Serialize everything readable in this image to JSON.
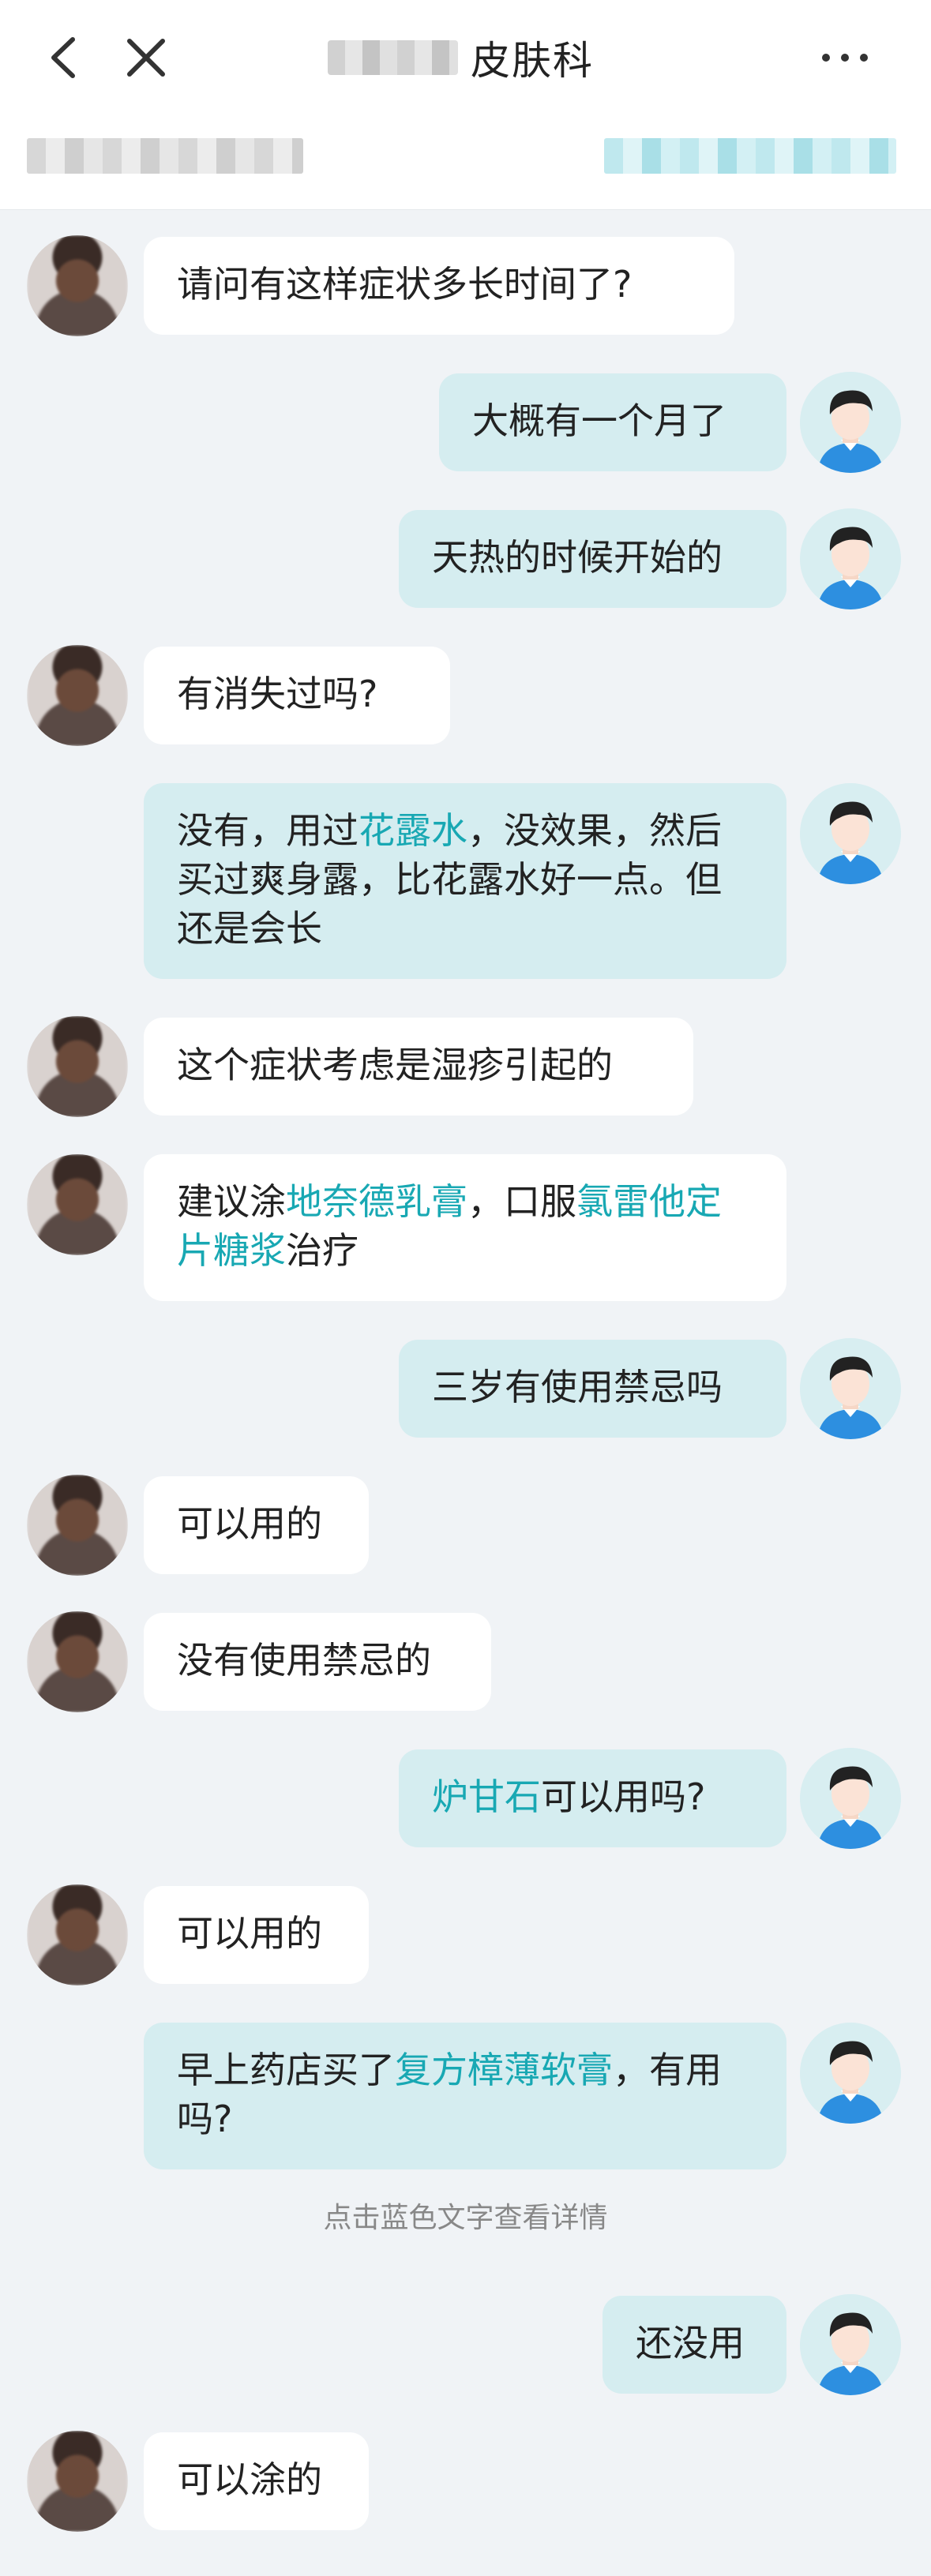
{
  "header": {
    "title": "皮肤科",
    "back_icon": "chevron-left-icon",
    "close_icon": "close-icon",
    "more_icon": "more-horizontal-icon"
  },
  "colors": {
    "link": "#18a8b3",
    "user_bubble": "#d5edf0",
    "doctor_bubble": "#ffffff",
    "background": "#f0f3f6"
  },
  "messages": [
    {
      "sender": "doctor",
      "parts": [
        {
          "text": "请问有这样症状多长时间了?"
        }
      ]
    },
    {
      "sender": "user",
      "parts": [
        {
          "text": "大概有一个月了"
        }
      ]
    },
    {
      "sender": "user",
      "parts": [
        {
          "text": "天热的时候开始的"
        }
      ]
    },
    {
      "sender": "doctor",
      "parts": [
        {
          "text": "有消失过吗?"
        }
      ]
    },
    {
      "sender": "user",
      "parts": [
        {
          "text": "没有，用过"
        },
        {
          "text": "花露水",
          "link": true
        },
        {
          "text": "，没效果，然后买过爽身露，比花露水好一点。但还是会长"
        }
      ]
    },
    {
      "sender": "doctor",
      "parts": [
        {
          "text": "这个症状考虑是湿疹引起的"
        }
      ]
    },
    {
      "sender": "doctor",
      "parts": [
        {
          "text": "建议涂"
        },
        {
          "text": "地奈德乳膏",
          "link": true
        },
        {
          "text": "，口服"
        },
        {
          "text": "氯雷他定片糖浆",
          "link": true
        },
        {
          "text": "治疗"
        }
      ]
    },
    {
      "sender": "user",
      "parts": [
        {
          "text": "三岁有使用禁忌吗"
        }
      ]
    },
    {
      "sender": "doctor",
      "parts": [
        {
          "text": "可以用的"
        }
      ]
    },
    {
      "sender": "doctor",
      "parts": [
        {
          "text": "没有使用禁忌的"
        }
      ]
    },
    {
      "sender": "user",
      "parts": [
        {
          "text": "炉甘石",
          "link": true
        },
        {
          "text": "可以用吗?"
        }
      ]
    },
    {
      "sender": "doctor",
      "parts": [
        {
          "text": "可以用的"
        }
      ]
    },
    {
      "sender": "user",
      "parts": [
        {
          "text": "早上药店买了"
        },
        {
          "text": "复方樟薄软膏",
          "link": true
        },
        {
          "text": "，有用吗?"
        }
      ]
    },
    {
      "sender": "user",
      "parts": [
        {
          "text": "还没用"
        }
      ]
    },
    {
      "sender": "doctor",
      "parts": [
        {
          "text": "可以涂的"
        }
      ]
    }
  ],
  "hint": "点击蓝色文字查看详情"
}
